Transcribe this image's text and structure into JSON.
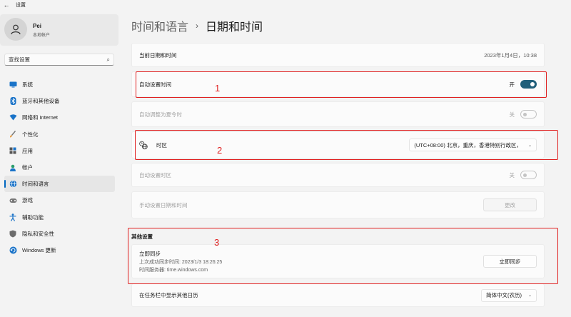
{
  "window": {
    "title": "设置",
    "back_icon": "back-arrow-icon"
  },
  "user": {
    "name": "Pei",
    "account_type": "本地帐户"
  },
  "search": {
    "placeholder": "查找设置"
  },
  "sidebar": {
    "items": [
      {
        "label": "系统",
        "icon": "monitor-icon",
        "active": false
      },
      {
        "label": "蓝牙和其他设备",
        "icon": "bluetooth-icon",
        "active": false
      },
      {
        "label": "网络和 Internet",
        "icon": "wifi-icon",
        "active": false
      },
      {
        "label": "个性化",
        "icon": "brush-icon",
        "active": false
      },
      {
        "label": "应用",
        "icon": "apps-icon",
        "active": false
      },
      {
        "label": "帐户",
        "icon": "person-icon",
        "active": false
      },
      {
        "label": "时间和语言",
        "icon": "globe-clock-icon",
        "active": true
      },
      {
        "label": "游戏",
        "icon": "gamepad-icon",
        "active": false
      },
      {
        "label": "辅助功能",
        "icon": "accessibility-icon",
        "active": false
      },
      {
        "label": "隐私和安全性",
        "icon": "shield-icon",
        "active": false
      },
      {
        "label": "Windows 更新",
        "icon": "update-icon",
        "active": false
      }
    ]
  },
  "header": {
    "parent": "时间和语言",
    "separator": "›",
    "current": "日期和时间"
  },
  "settings": {
    "current_datetime": {
      "label": "当前日期和时间",
      "value": "2023年1月4日，10:38"
    },
    "auto_time": {
      "label": "自动设置时间",
      "state_text": "开",
      "on": true
    },
    "auto_dst": {
      "label": "自动调整为夏令时",
      "state_text": "关",
      "on": false
    },
    "timezone": {
      "label": "时区",
      "value": "(UTC+08:00) 北京，重庆，香港特别行政区，"
    },
    "auto_timezone": {
      "label": "自动设置时区",
      "state_text": "关",
      "on": false
    },
    "manual_datetime": {
      "label": "手动设置日期和时间",
      "button": "更改"
    }
  },
  "other": {
    "title": "其他设置",
    "sync": {
      "title": "立即同步",
      "last_sync": "上次成功同步时间: 2023/1/3 18:26:25",
      "server": "时间服务器: time.windows.com",
      "button": "立即同步"
    },
    "calendar": {
      "label": "在任务栏中显示其他日历",
      "value": "简体中文(农历)"
    }
  },
  "annotations": [
    "1",
    "2",
    "3"
  ],
  "colors": {
    "accent": "#205f7a",
    "annotation": "#e02020",
    "nav_indicator": "#0067c0"
  }
}
